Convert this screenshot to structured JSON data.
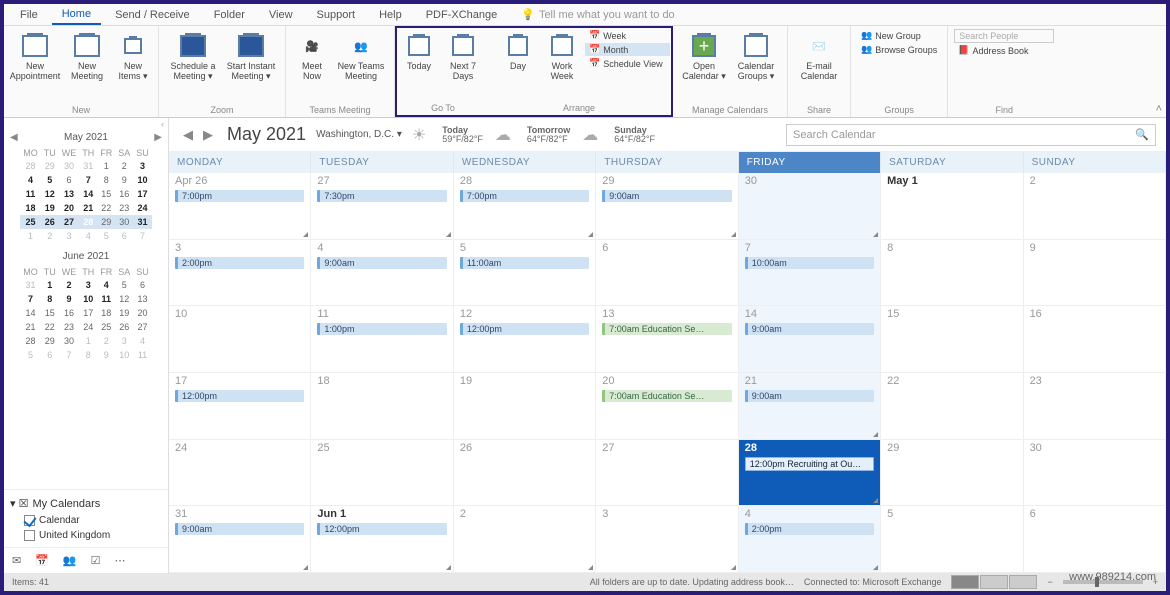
{
  "tabs": {
    "items": [
      "File",
      "Home",
      "Send / Receive",
      "Folder",
      "View",
      "Support",
      "Help",
      "PDF-XChange"
    ],
    "active": 1,
    "tell": "Tell me what you want to do"
  },
  "ribbon": {
    "new": {
      "label": "New",
      "appointment": "New\nAppointment",
      "meeting": "New\nMeeting",
      "items": "New\nItems ▾"
    },
    "zoom": {
      "label": "Zoom",
      "schedule": "Schedule a\nMeeting ▾",
      "instant": "Start Instant\nMeeting ▾"
    },
    "teams": {
      "label": "Teams Meeting",
      "meetnow": "Meet\nNow",
      "newteams": "New Teams\nMeeting"
    },
    "goto": {
      "label": "Go To",
      "today": "Today",
      "next7": "Next 7\nDays"
    },
    "arrange": {
      "label": "Arrange",
      "day": "Day",
      "workweek": "Work\nWeek",
      "week": "Week",
      "month": "Month",
      "schedview": "Schedule View"
    },
    "managecal": {
      "label": "Manage Calendars",
      "open": "Open\nCalendar ▾",
      "groups": "Calendar\nGroups ▾"
    },
    "share": {
      "label": "Share",
      "email": "E-mail\nCalendar"
    },
    "groups": {
      "label": "Groups",
      "newgrp": "New Group",
      "browse": "Browse Groups"
    },
    "find": {
      "label": "Find",
      "searchppl": "Search People",
      "addrbook": "Address Book"
    }
  },
  "sidebar": {
    "month1": "May 2021",
    "month2": "June 2021",
    "dow": [
      "MO",
      "TU",
      "WE",
      "TH",
      "FR",
      "SA",
      "SU"
    ],
    "mycal": {
      "title": "My Calendars",
      "items": [
        {
          "label": "Calendar",
          "checked": true
        },
        {
          "label": "United Kingdom",
          "checked": false
        }
      ]
    }
  },
  "header": {
    "month": "May 2021",
    "location": "Washington, D.C. ▾",
    "weather": [
      {
        "day": "Today",
        "temp": "59°F/82°F"
      },
      {
        "day": "Tomorrow",
        "temp": "64°F/82°F"
      },
      {
        "day": "Sunday",
        "temp": "64°F/82°F"
      }
    ],
    "search_placeholder": "Search Calendar"
  },
  "calendar": {
    "days": [
      "MONDAY",
      "TUESDAY",
      "WEDNESDAY",
      "THURSDAY",
      "FRIDAY",
      "SATURDAY",
      "SUNDAY"
    ],
    "weeks": [
      [
        {
          "n": "Apr 26",
          "ev": [
            {
              "t": "7:00pm",
              "c": 1
            }
          ],
          "tri": true
        },
        {
          "n": "27",
          "ev": [
            {
              "t": "7:30pm",
              "c": 1
            }
          ],
          "tri": true
        },
        {
          "n": "28",
          "ev": [
            {
              "t": "7:00pm",
              "c": 1
            }
          ],
          "tri": true
        },
        {
          "n": "29",
          "ev": [
            {
              "t": "9:00am",
              "c": 1
            }
          ],
          "tri": true
        },
        {
          "n": "30",
          "fri": true,
          "tri": true
        },
        {
          "n": "May 1",
          "bold": true
        },
        {
          "n": "2"
        }
      ],
      [
        {
          "n": "3",
          "ev": [
            {
              "t": "2:00pm",
              "c": 1
            }
          ]
        },
        {
          "n": "4",
          "ev": [
            {
              "t": "9:00am",
              "c": 1,
              "wide": true
            }
          ]
        },
        {
          "n": "5",
          "ev": [
            {
              "t": "11:00am",
              "c": 1,
              "wide": true
            }
          ]
        },
        {
          "n": "6"
        },
        {
          "n": "7",
          "fri": true,
          "ev": [
            {
              "t": "10:00am",
              "c": 1,
              "wide": true
            }
          ]
        },
        {
          "n": "8"
        },
        {
          "n": "9"
        }
      ],
      [
        {
          "n": "10"
        },
        {
          "n": "11",
          "ev": [
            {
              "t": "1:00pm",
              "c": 1
            }
          ]
        },
        {
          "n": "12",
          "ev": [
            {
              "t": "12:00pm",
              "c": 1
            }
          ]
        },
        {
          "n": "13",
          "ev": [
            {
              "t": "7:00am Education Se…",
              "c": 2
            }
          ]
        },
        {
          "n": "14",
          "fri": true,
          "ev": [
            {
              "t": "9:00am",
              "c": 1
            }
          ]
        },
        {
          "n": "15"
        },
        {
          "n": "16"
        }
      ],
      [
        {
          "n": "17",
          "ev": [
            {
              "t": "12:00pm",
              "c": 1
            }
          ]
        },
        {
          "n": "18"
        },
        {
          "n": "19"
        },
        {
          "n": "20",
          "ev": [
            {
              "t": "7:00am Education Se…",
              "c": 2
            }
          ]
        },
        {
          "n": "21",
          "fri": true,
          "ev": [
            {
              "t": "9:00am",
              "c": 1
            }
          ],
          "tri": true
        },
        {
          "n": "22"
        },
        {
          "n": "23"
        }
      ],
      [
        {
          "n": "24"
        },
        {
          "n": "25"
        },
        {
          "n": "26"
        },
        {
          "n": "27"
        },
        {
          "n": "28",
          "fri": true,
          "today": true,
          "ev": [
            {
              "t": "12:00pm Recruiting at Ou…",
              "c": 0
            }
          ],
          "tri": true
        },
        {
          "n": "29"
        },
        {
          "n": "30"
        }
      ],
      [
        {
          "n": "31",
          "ev": [
            {
              "t": "9:00am",
              "c": 1
            }
          ],
          "tri": true
        },
        {
          "n": "Jun 1",
          "bold": true,
          "ev": [
            {
              "t": "12:00pm",
              "c": 1
            }
          ],
          "tri": true
        },
        {
          "n": "2",
          "tri": true
        },
        {
          "n": "3",
          "tri": true
        },
        {
          "n": "4",
          "fri": true,
          "ev": [
            {
              "t": "2:00pm",
              "c": 1
            }
          ],
          "tri": true
        },
        {
          "n": "5"
        },
        {
          "n": "6"
        }
      ]
    ]
  },
  "status": {
    "items_text": "Items: 41",
    "folder_text": "All folders are up to date.   Updating address book…",
    "conn": "Connected to: Microsoft Exchange"
  },
  "watermark": "www.989214.com"
}
